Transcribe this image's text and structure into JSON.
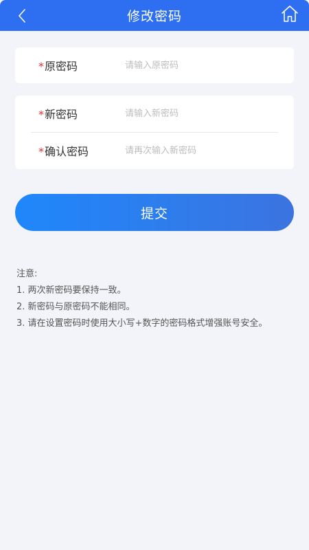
{
  "header": {
    "title": "修改密码"
  },
  "form": {
    "old_password": {
      "required_mark": "*",
      "label": "原密码",
      "placeholder": "请输入原密码"
    },
    "new_password": {
      "required_mark": "*",
      "label": "新密码",
      "placeholder": "请输入新密码"
    },
    "confirm_password": {
      "required_mark": "*",
      "label": "确认密码",
      "placeholder": "请再次输入新密码"
    }
  },
  "submit_label": "提交",
  "notes": {
    "heading": "注意:",
    "items": [
      "1. 两次新密码要保持一致。",
      "2. 新密码与原密码不能相同。",
      "3. 请在设置密码时使用大小写+数字的密码格式增强账号安全。"
    ]
  },
  "colors": {
    "header_bg": "#2d6ff0",
    "button_gradient_start": "#1f87fb",
    "button_gradient_end": "#3b74e0",
    "required_mark": "#e0312d",
    "page_bg": "#f3f4f9"
  },
  "icons": {
    "back": "chevron-left-icon",
    "home": "home-icon"
  }
}
